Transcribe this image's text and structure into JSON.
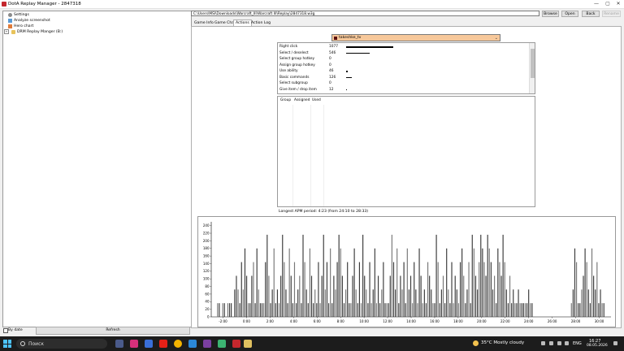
{
  "window": {
    "title": "DotA Replay Manager - 2847318",
    "min": "—",
    "max": "▢",
    "close": "✕"
  },
  "tree": {
    "items": [
      {
        "label": "Settings",
        "icon": "gear-icon"
      },
      {
        "label": "Analyze screenshot",
        "icon": "image-icon"
      },
      {
        "label": "Hero chart",
        "icon": "chart-icon"
      },
      {
        "label": "DRM Replay Manger (B:)",
        "icon": "folder-icon",
        "expander": "+"
      }
    ]
  },
  "bottom": {
    "by_date": "By date",
    "refresh": "Refresh"
  },
  "toolbar": {
    "path": "C:\\Users\\MSI\\Downloads\\Warcraft_III\\Warcraft III\\Replay\\2847318.w3g",
    "browse": "Browse",
    "open": "Open",
    "back": "Back",
    "rename": "Rename"
  },
  "tabs": [
    {
      "label": "Game Info"
    },
    {
      "label": "Game Chat"
    },
    {
      "label": "Actions"
    },
    {
      "label": "Action Log"
    }
  ],
  "player": {
    "name": "takeshke_tv",
    "color": "#5a0e0e",
    "arrow": "⌄"
  },
  "actions": [
    {
      "name": "Right click",
      "count": "1077",
      "bar": 1077
    },
    {
      "name": "Select / deselect",
      "count": "546",
      "bar": 546
    },
    {
      "name": "Select group hotkey",
      "count": "0",
      "bar": 0
    },
    {
      "name": "Assign group hotkey",
      "count": "0",
      "bar": 0
    },
    {
      "name": "Use ability",
      "count": "46",
      "bar": 46
    },
    {
      "name": "Basic commands",
      "count": "126",
      "bar": 126
    },
    {
      "name": "Select subgroup",
      "count": "0",
      "bar": 0
    },
    {
      "name": "Give item / drop item",
      "count": "12",
      "bar": 12
    }
  ],
  "groups": {
    "headers": [
      "Group",
      "Assigned",
      "Used"
    ]
  },
  "longest_apm": "Longest APM period: 4:23 (from 24:10 to 28:33)",
  "taskbar": {
    "search": "Поиск",
    "weather": "35°C  Mostly cloudy",
    "lang": "ENG",
    "time": "16:27",
    "date": "08.05.2026"
  },
  "chart_data": {
    "type": "bar",
    "y_ticks": [
      "240",
      "220",
      "200",
      "180",
      "160",
      "140",
      "120",
      "100",
      "80",
      "60",
      "40",
      "20",
      "0"
    ],
    "ylim": [
      0,
      250
    ],
    "x_ticks": [
      "-2:00",
      "0:00",
      "2:00",
      "4:00",
      "6:00",
      "8:00",
      "10:00",
      "12:00",
      "14:00",
      "16:00",
      "18:00",
      "20:00",
      "22:00",
      "24:00",
      "26:00",
      "28:00",
      "30:00"
    ],
    "xlim": [
      -3,
      31
    ],
    "values": [
      36,
      36,
      0,
      36,
      36,
      0,
      36,
      36,
      36,
      0,
      72,
      108,
      72,
      36,
      144,
      72,
      180,
      108,
      36,
      36,
      108,
      144,
      36,
      180,
      72,
      36,
      36,
      36,
      144,
      216,
      108,
      36,
      72,
      180,
      36,
      72,
      36,
      108,
      216,
      144,
      72,
      36,
      180,
      108,
      36,
      144,
      36,
      72,
      108,
      36,
      216,
      144,
      72,
      36,
      180,
      108,
      36,
      72,
      36,
      144,
      36,
      108,
      216,
      72,
      144,
      36,
      180,
      36,
      108,
      72,
      144,
      216,
      180,
      108,
      36,
      72,
      144,
      36,
      36,
      108,
      180,
      72,
      36,
      144,
      36,
      216,
      108,
      72,
      36,
      144,
      36,
      72,
      180,
      36,
      108,
      36,
      72,
      144,
      36,
      36,
      36,
      108,
      216,
      144,
      72,
      180,
      36,
      108,
      72,
      144,
      36,
      180,
      72,
      108,
      36,
      144,
      72,
      36,
      180,
      108,
      36,
      72,
      36,
      144,
      108,
      72,
      36,
      36,
      216,
      144,
      36,
      72,
      108,
      36,
      180,
      72,
      36,
      144,
      36,
      108,
      72,
      36,
      144,
      180,
      108,
      36,
      72,
      144,
      36,
      216,
      180,
      108,
      72,
      144,
      216,
      180,
      144,
      108,
      216,
      180,
      144,
      72,
      108,
      36,
      180,
      144,
      108,
      216,
      144,
      72,
      36,
      108,
      36,
      72,
      36,
      36,
      72,
      36,
      36,
      36,
      36,
      36,
      72,
      36,
      36,
      0,
      0,
      0,
      0,
      0,
      0,
      0,
      0,
      0,
      0,
      0,
      0,
      0,
      0,
      0,
      0,
      0,
      0,
      0,
      0,
      0,
      0,
      36,
      72,
      180,
      144,
      36,
      36,
      72,
      108,
      180,
      144,
      72,
      36,
      180,
      108,
      72,
      144,
      36,
      72,
      36,
      36
    ]
  }
}
